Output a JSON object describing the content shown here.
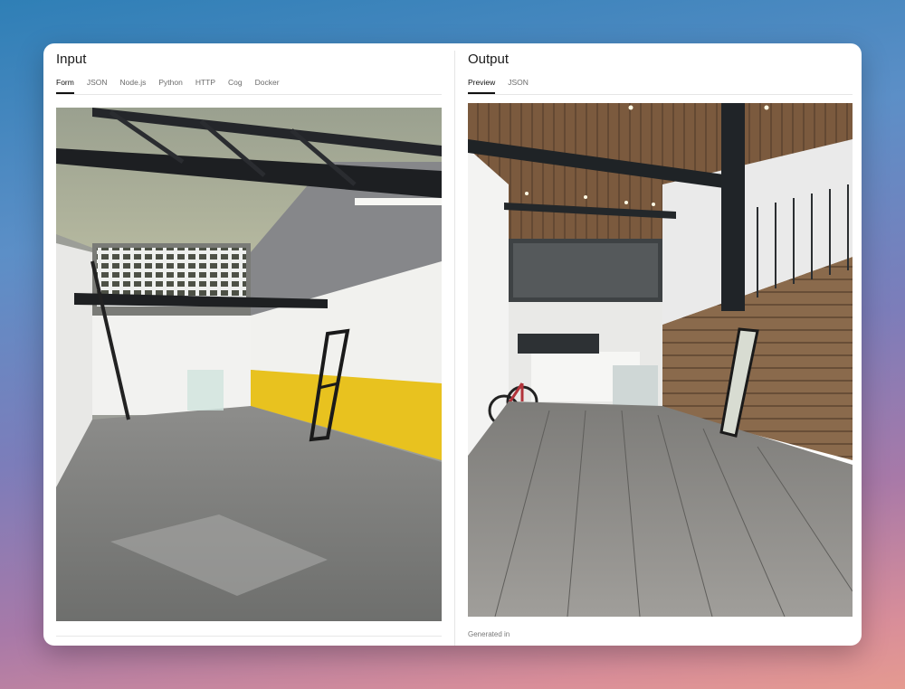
{
  "input": {
    "title": "Input",
    "tabs": [
      "Form",
      "JSON",
      "Node.js",
      "Python",
      "HTTP",
      "Cog",
      "Docker"
    ],
    "image_alt": "Empty warehouse interior with concrete floor, yellow wall stripe and steel beams"
  },
  "output": {
    "title": "Output",
    "tabs": [
      "Preview",
      "JSON"
    ],
    "image_alt": "Renovated loft with wooden ceiling, wood-panel walls, gray wood floor and bicycle",
    "generated_label": "Generated in"
  },
  "colors": {
    "accent_yellow": "#e8c21f",
    "card_bg": "#ffffff",
    "tab_active": "#111111"
  }
}
